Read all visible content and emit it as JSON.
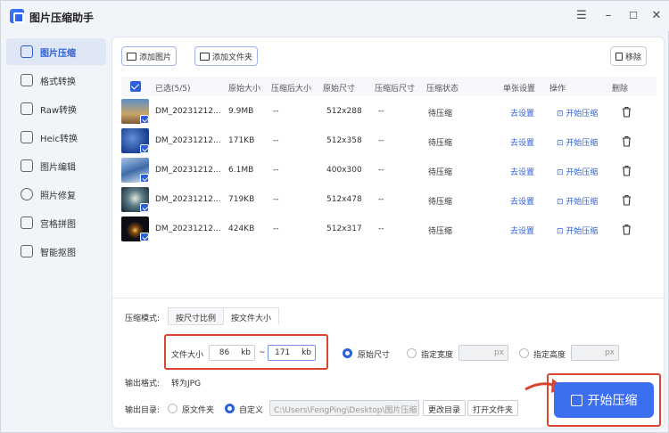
{
  "app": {
    "title": "图片压缩助手"
  },
  "sidebar": {
    "items": [
      {
        "label": "图片压缩",
        "active": true
      },
      {
        "label": "格式转换"
      },
      {
        "label": "Raw转换"
      },
      {
        "label": "Heic转换"
      },
      {
        "label": "图片编辑"
      },
      {
        "label": "照片修复"
      },
      {
        "label": "宫格拼图"
      },
      {
        "label": "智能抠图"
      }
    ]
  },
  "toolbar": {
    "add_image": "添加图片",
    "add_folder": "添加文件夹",
    "remove": "移除"
  },
  "table": {
    "headers": [
      "已选(5/5)",
      "原始大小",
      "压缩后大小",
      "原始尺寸",
      "压缩后尺寸",
      "压缩状态",
      "单张设置",
      "操作",
      "删除"
    ],
    "rows": [
      {
        "name": "DM_20231212...",
        "orig_size": "9.9MB",
        "comp_size": "--",
        "orig_dim": "512x288",
        "comp_dim": "--",
        "status": "待压缩",
        "setting": "去设置",
        "action": "开始压缩"
      },
      {
        "name": "DM_20231212...",
        "orig_size": "171KB",
        "comp_size": "--",
        "orig_dim": "512x358",
        "comp_dim": "--",
        "status": "待压缩",
        "setting": "去设置",
        "action": "开始压缩"
      },
      {
        "name": "DM_20231212...",
        "orig_size": "6.1MB",
        "comp_size": "--",
        "orig_dim": "400x300",
        "comp_dim": "--",
        "status": "待压缩",
        "setting": "去设置",
        "action": "开始压缩"
      },
      {
        "name": "DM_20231212...",
        "orig_size": "719KB",
        "comp_size": "--",
        "orig_dim": "512x478",
        "comp_dim": "--",
        "status": "待压缩",
        "setting": "去设置",
        "action": "开始压缩"
      },
      {
        "name": "DM_20231212...",
        "orig_size": "424KB",
        "comp_size": "--",
        "orig_dim": "512x317",
        "comp_dim": "--",
        "status": "待压缩",
        "setting": "去设置",
        "action": "开始压缩"
      }
    ]
  },
  "settings": {
    "mode_label": "压缩模式:",
    "tabs": [
      "按尺寸比例",
      "按文件大小"
    ],
    "selected_tab": "按文件大小",
    "file_size_label": "文件大小",
    "min_value": "86",
    "max_value": "171",
    "unit": "kb",
    "range_sep": "~",
    "original_size": "原始尺寸",
    "fixed_width": "指定宽度",
    "fixed_height": "指定高度",
    "px": "px",
    "output_format_label": "输出格式:",
    "output_format_value": "转为JPG",
    "output_dir_label": "输出目录:",
    "source_folder": "原文件夹",
    "custom": "自定义",
    "path": "C:\\Users\\FengPing\\Desktop\\图片压缩",
    "change_dir": "更改目录",
    "open_folder": "打开文件夹"
  },
  "start_button": "开始压缩",
  "colors": {
    "accent": "#3b6ff0",
    "highlight": "#d9452f"
  }
}
